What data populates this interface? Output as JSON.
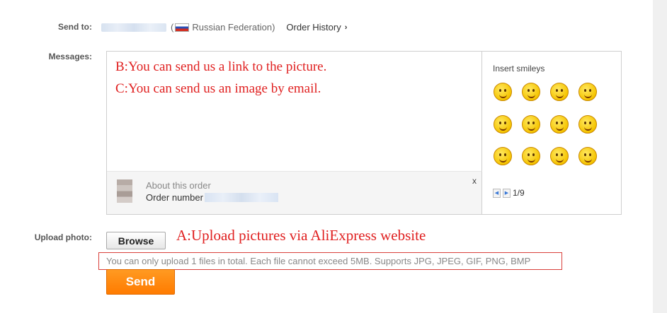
{
  "form": {
    "send_to_label": "Send to:",
    "country": "Russian Federation",
    "country_open_paren": "(",
    "country_close_paren": ")",
    "order_history_link": "Order History",
    "messages_label": "Messages:",
    "upload_label": "Upload photo:"
  },
  "message": {
    "lines": [
      "B:You can send us a link to the picture.",
      "C:You can send us an image by email."
    ]
  },
  "order_info": {
    "about": "About this order",
    "order_number_label": "Order number",
    "close": "x"
  },
  "smileys": {
    "title": "Insert smileys",
    "icons": [
      "smile-icon",
      "kiss-icon",
      "tongue-icon",
      "giggle-icon",
      "party-blow-icon",
      "shout-icon",
      "laugh-tears-icon",
      "cover-mouth-icon",
      "sad-hug-icon",
      "hug-icon",
      "smirk-icon",
      "thinking-icon"
    ],
    "pager": "1/9"
  },
  "upload": {
    "browse_label": "Browse",
    "annotation": "A:Upload pictures via AliExpress website",
    "hint": "You can only upload 1 files in total. Each file cannot exceed 5MB. Supports JPG, JPEG, GIF, PNG, BMP"
  },
  "actions": {
    "send_label": "Send"
  },
  "colors": {
    "annotation_red": "#e02020",
    "send_orange": "#ff8a10"
  }
}
